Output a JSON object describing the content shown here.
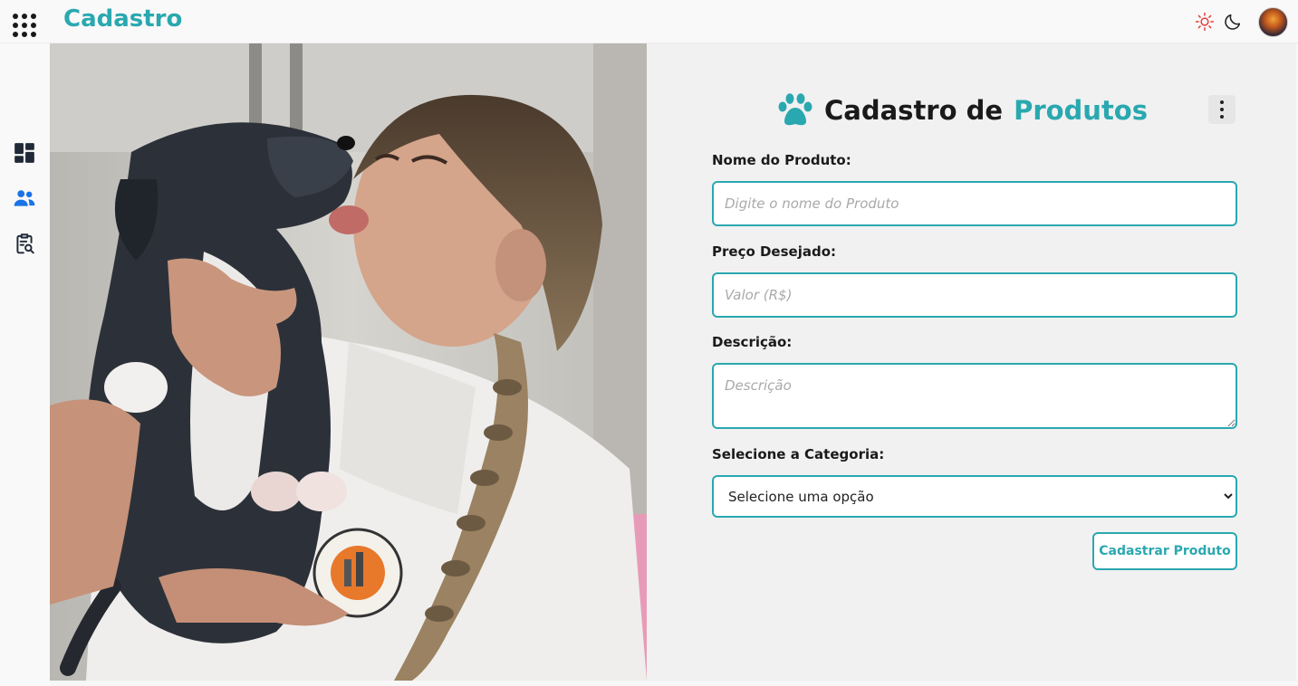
{
  "header": {
    "app_title": "Cadastro",
    "menu_icon": "apps-grid-icon",
    "theme_light_icon": "sun-icon",
    "theme_dark_icon": "moon-icon",
    "avatar_icon": "avatar",
    "accent_color": "#2aa8b0",
    "sun_color": "#e53935"
  },
  "sidebar": {
    "items": [
      {
        "icon": "dashboard-icon"
      },
      {
        "icon": "users-icon",
        "active": true,
        "color": "#1a73e8"
      },
      {
        "icon": "clipboard-search-icon"
      }
    ]
  },
  "form": {
    "title_part1": "Cadastro de",
    "title_part2": "Produtos",
    "title_icon": "paw-icon",
    "menu_icon": "more-vertical-icon",
    "name_label": "Nome do Produto:",
    "name_placeholder": "Digite o nome do Produto",
    "price_label": "Preço Desejado:",
    "price_placeholder": "Valor (R$)",
    "description_label": "Descrição:",
    "description_placeholder": "Descrição",
    "category_label": "Selecione a Categoria:",
    "category_selected": "Selecione uma opção",
    "submit_label": "Cadastrar Produto"
  }
}
